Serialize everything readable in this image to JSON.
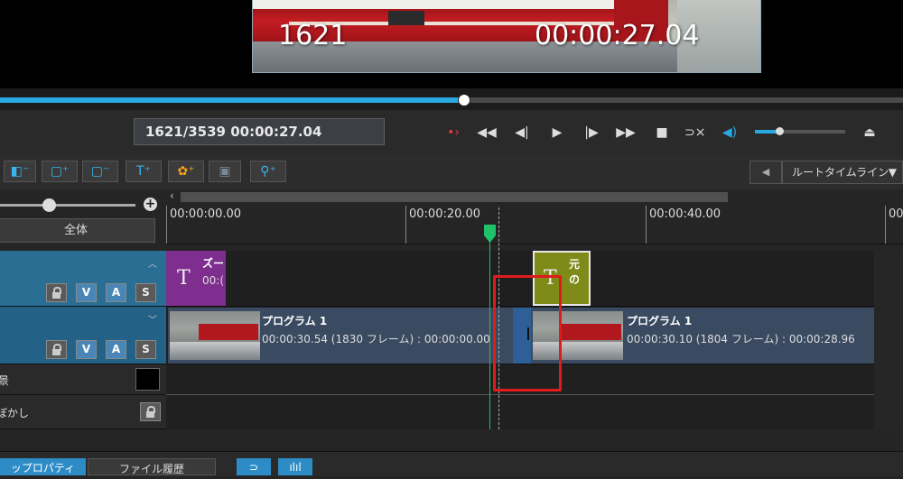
{
  "preview": {
    "overlay_frame": "1621",
    "overlay_timecode": "00:00:27.04"
  },
  "seek": {
    "progress_fraction": 0.513
  },
  "transport": {
    "timecode_display": "1621/3539  00:00:27.04",
    "buttons": [
      {
        "name": "record-icon",
        "glyph": "•›"
      },
      {
        "name": "rewind-icon",
        "glyph": "◀◀"
      },
      {
        "name": "prev-frame-icon",
        "glyph": "◀|"
      },
      {
        "name": "play-icon",
        "glyph": "▶"
      },
      {
        "name": "next-frame-icon",
        "glyph": "|▶"
      },
      {
        "name": "fast-forward-icon",
        "glyph": "▶▶"
      },
      {
        "name": "stop-icon",
        "glyph": "■"
      },
      {
        "name": "loop-icon",
        "glyph": "⊃×"
      },
      {
        "name": "speaker-icon",
        "glyph": "◀)"
      }
    ],
    "volume_fraction": 0.27,
    "eject_glyph": "⏏"
  },
  "toolbar": {
    "tools": [
      {
        "name": "tool-remove-track-icon",
        "glyph": "◧⁻"
      },
      {
        "name": "tool-add-clip-icon",
        "glyph": "▢⁺"
      },
      {
        "name": "tool-remove-clip-icon",
        "glyph": "▢⁻"
      },
      {
        "name": "tool-add-text-icon",
        "glyph": "T⁺"
      },
      {
        "name": "tool-add-effect-icon",
        "glyph": "✿⁺"
      },
      {
        "name": "tool-subtitle-icon",
        "glyph": "▣"
      },
      {
        "name": "tool-add-marker-icon",
        "glyph": "⚲⁺"
      }
    ],
    "timeline_select": "ルートタイムライン"
  },
  "left_panel": {
    "zoom_fraction": 0.31,
    "fit_button": "全体",
    "track_labels": {
      "bg": "景",
      "blur": "ぼかし"
    }
  },
  "ruler": {
    "labels": [
      "00:00:00.00",
      "00:00:20.00",
      "00:00:40.00",
      "00:0"
    ]
  },
  "clips": {
    "text1": {
      "title": "ズー",
      "sub": "00:("
    },
    "text2": {
      "title": "元の"
    },
    "prog1": {
      "title": "プログラム 1",
      "sub": "00:00:30.54 (1830 フレーム) :  00:00:00.00"
    },
    "prog2": {
      "title": "プログラム 1",
      "sub": "00:00:30.10 (1804 フレーム) :  00:00:28.96"
    }
  },
  "bottom": {
    "tab_clip_props": "ップロパティ",
    "tab_history": "ファイル履歴"
  },
  "colors": {
    "accent": "#2aa8e0",
    "playhead": "#1fc26a",
    "highlight": "#e01b1b",
    "text_clip_purple": "#7e2e8e",
    "text_clip_olive": "#7f8a19"
  }
}
